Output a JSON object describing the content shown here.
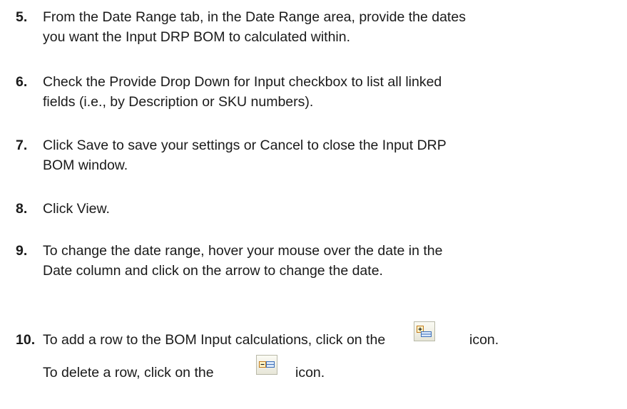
{
  "steps": [
    {
      "num": "5.",
      "line1": "From the Date Range tab, in the Date Range area, provide the dates",
      "line2": "you want the Input DRP BOM to calculated within."
    },
    {
      "num": "6.",
      "line1": "Check the Provide Drop Down for Input checkbox to list all linked",
      "line2": "fields (i.e., by Description or SKU numbers)."
    },
    {
      "num": "7.",
      "line1": "Click Save to save your settings or Cancel to close the Input DRP",
      "line2": "BOM window."
    },
    {
      "num": "8.",
      "line1": "Click View."
    },
    {
      "num": "9.",
      "line1": "To change the date range, hover your mouse over the date in the",
      "line2": "Date column and click on the arrow to change the date."
    },
    {
      "num": "10.",
      "add_text": "To add a row to the BOM Input calculations, click on the",
      "add_suffix": "icon.",
      "delete_text": "To delete a row, click on the",
      "delete_suffix": "icon."
    }
  ],
  "icons": {
    "add_row": "add-row-icon",
    "delete_row": "delete-row-icon"
  }
}
